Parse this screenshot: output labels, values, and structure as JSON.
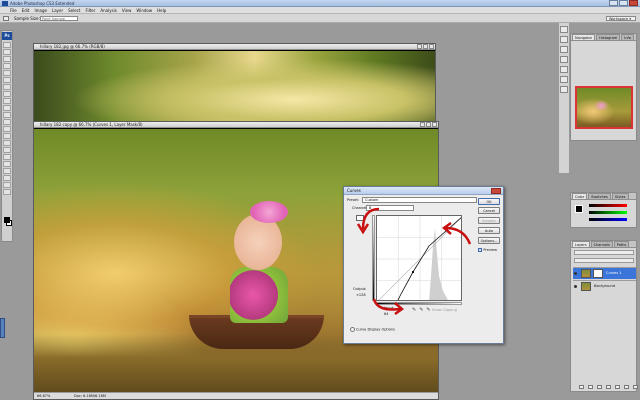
{
  "app": {
    "title": "Adobe Photoshop CS3 Extended"
  },
  "menu": [
    "File",
    "Edit",
    "Image",
    "Layer",
    "Select",
    "Filter",
    "Analysis",
    "View",
    "Window",
    "Help"
  ],
  "options_bar": {
    "sample_size_label": "Sample Size:",
    "sample_size_value": "Point Sample",
    "workspace_label": "Workspace ▾"
  },
  "toolbox": {
    "logo": "Ps"
  },
  "docs": {
    "back_title": "hillary 182.jpg @ 66.7% (RGB/8)",
    "front_title": "hillary 182 copy @ 66.7% (Curves 1, Layer Mask/8)",
    "zoom": "66.67%",
    "doc_info": "Doc: 6.18M/6.18M"
  },
  "curves": {
    "title": "Curves",
    "preset_label": "Preset:",
    "preset_value": "Custom",
    "channel_label": "Channel:",
    "channel_value": "B",
    "ok": "OK",
    "cancel": "Cancel",
    "smooth": "Smooth",
    "auto": "Auto",
    "options": "Options...",
    "preview_label": "Preview",
    "output_label": "Output:",
    "output_value": "<128",
    "input_label": "Input:",
    "input_value": "64",
    "show_clipping": "Show Clipping",
    "display_options": "Curve Display Options"
  },
  "panels": {
    "navigator_tabs": [
      "Navigator",
      "Histogram",
      "Info"
    ],
    "color_tabs": [
      "Color",
      "Swatches",
      "Styles"
    ],
    "layers_tabs": [
      "Layers",
      "Channels",
      "Paths"
    ],
    "layers": [
      {
        "name": "Curves 1",
        "selected": true
      },
      {
        "name": "Background",
        "selected": false
      }
    ]
  },
  "colors": {
    "accent": "#3c75d9",
    "annotation_arrows": "#c81010"
  }
}
